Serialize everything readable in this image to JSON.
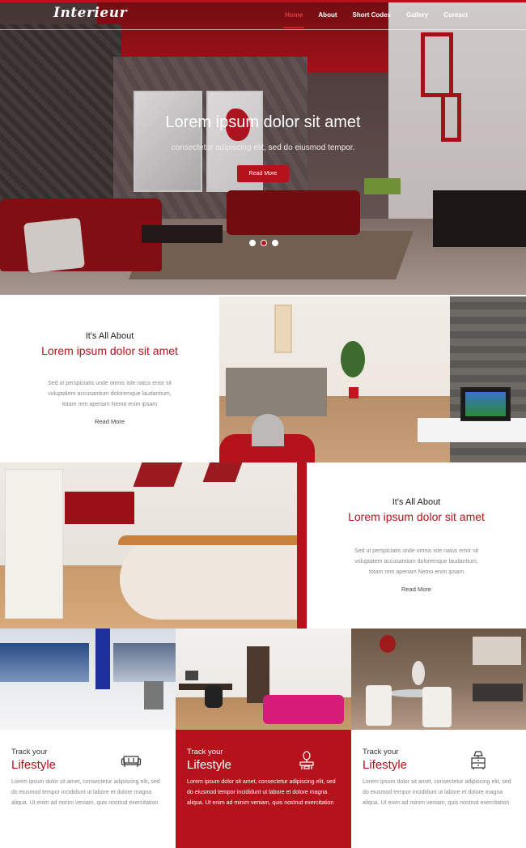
{
  "brand": {
    "logo": "Interieur",
    "accent": "#b5121b"
  },
  "nav": {
    "items": [
      {
        "label": "Home",
        "active": true
      },
      {
        "label": "About"
      },
      {
        "label": "Short Codes"
      },
      {
        "label": "Gallery"
      },
      {
        "label": "Contact"
      }
    ]
  },
  "hero": {
    "title": "Lorem ipsum dolor sit amet",
    "subtitle": "consectetur adipiscing elit, sed do eiusmod tempor.",
    "button": "Read More",
    "slides": 3,
    "active_slide": 2
  },
  "about": [
    {
      "kicker": "It's All About",
      "title": "Lorem ipsum dolor sit amet",
      "body": "Sed ut perspiciatis unde omnis iste natus error sit voluptatem accusantium doloremque laudantium, totam rem aperiam Nemo enim ipsam",
      "more": "Read More"
    },
    {
      "kicker": "It's All About",
      "title": "Lorem ipsum dolor sit amet",
      "body": "Sed ut perspiciatis unde omnis iste natus error sit voluptatem accusantium doloremque laudantium, totam rem aperiam Nemo enim ipsam",
      "more": "Read More"
    }
  ],
  "features": [
    {
      "track": "Track your",
      "title": "Lifestyle",
      "body": "Lorem ipsum dolor sit amet, consectetur adipiscing elit, sed do eiusmod tempor incididunt ut labore et dolore magna aliqua. Ut enim ad minim veniam, quis nostrud exercitation",
      "icon": "sofa-icon"
    },
    {
      "track": "Track your",
      "title": "Lifestyle",
      "body": "Lorem ipsum dolor sit amet, consectetur adipiscing elit, sed do eiusmod tempor incididunt ut labore et dolore magna aliqua. Ut enim ad minim veniam, quis nostrud exercitation",
      "icon": "vanity-mirror-icon"
    },
    {
      "track": "Track your",
      "title": "Lifestyle",
      "body": "Lorem ipsum dolor sit amet, consectetur adipiscing elit, sed do eiusmod tempor incididunt ut labore et dolore magna aliqua. Ut enim ad minim veniam, quis nostrud exercitation",
      "icon": "nightstand-lamp-icon"
    }
  ]
}
